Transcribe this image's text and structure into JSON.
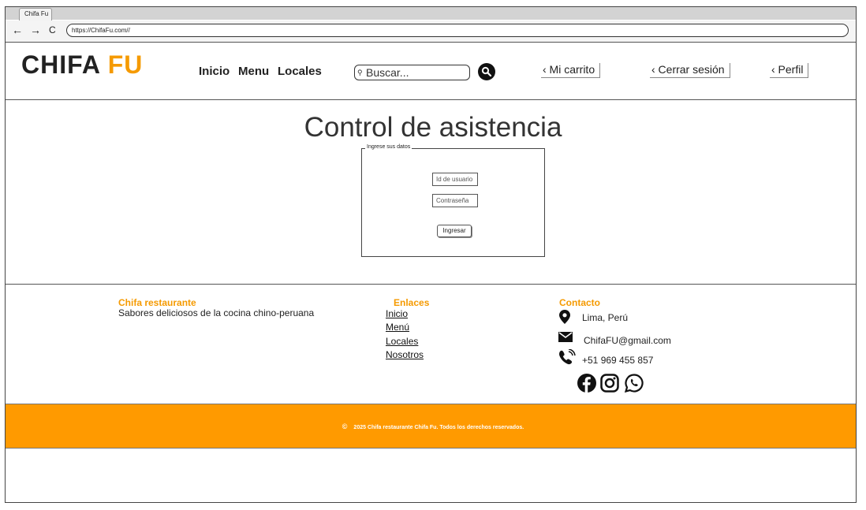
{
  "browser": {
    "tab_title": "Chifa Fu",
    "url": "https://ChifaFu.com//",
    "back": "←",
    "forward": "→",
    "reload": "C"
  },
  "header": {
    "logo_main": "CHIFA ",
    "logo_accent": "FU",
    "nav": [
      "Inicio",
      "Menu",
      "Locales"
    ],
    "search_placeholder": "Buscar...",
    "cart": "‹ Mi carrito",
    "logout": "‹ Cerrar sesión",
    "profile": "‹ Perfil"
  },
  "main": {
    "title": "Control de asistencia",
    "legend": "Ingrese sus datos",
    "user_placeholder": "Id de usuario",
    "password_placeholder": "Contraseña",
    "submit": "Ingresar"
  },
  "footer": {
    "col1_title": "Chifa restaurante",
    "col1_text": "Sabores deliciosos de la cocina chino-peruana",
    "col2_title": "Enlaces",
    "links": [
      "Inicio",
      "Menú",
      "Locales",
      "Nosotros"
    ],
    "col3_title": "Contacto",
    "location": "Lima, Perú",
    "email": "ChifaFU@gmail.com",
    "phone": "+51 969 455 857",
    "social_icons": [
      "facebook-icon",
      "instagram-icon",
      "whatsapp-icon"
    ],
    "copyright_symbol": "©",
    "copyright": "2025 Chifa restaurante Chifa Fu. Todos los derechos reservados."
  },
  "colors": {
    "accent": "#f59a00",
    "footer_bar": "#ff9a00"
  }
}
